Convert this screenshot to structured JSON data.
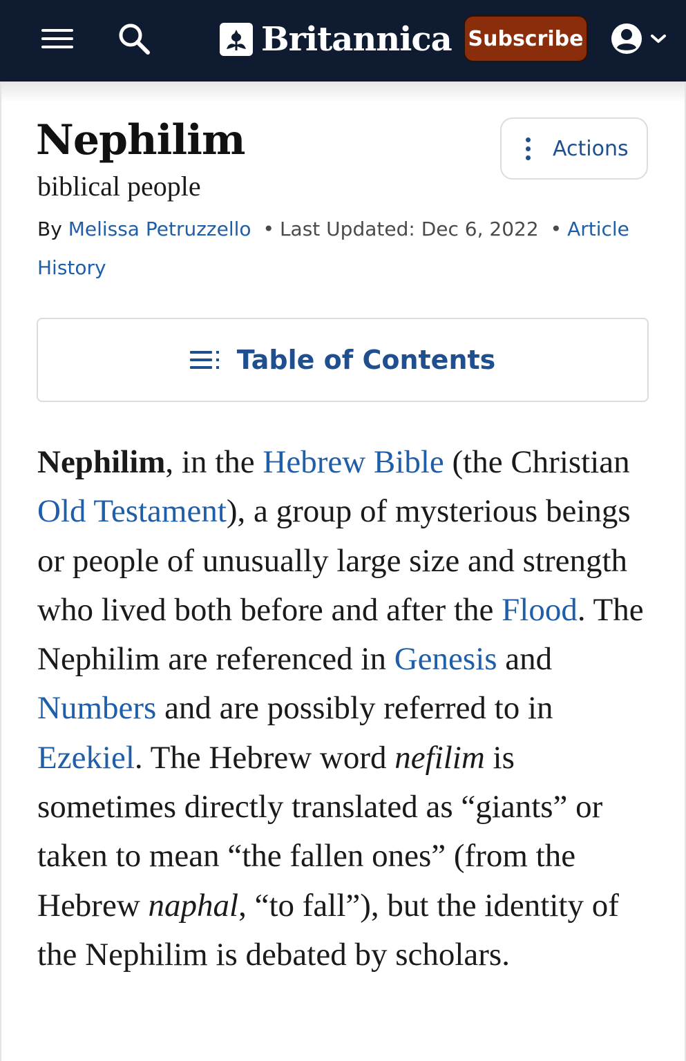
{
  "header": {
    "brand": "Britannica",
    "subscribe_label": "Subscribe",
    "background_color": "#0f1b30",
    "subscribe_color": "#8a2d0b",
    "icons": [
      "menu-icon",
      "search-icon",
      "thistle-logo-icon",
      "account-icon",
      "chevron-down-icon"
    ]
  },
  "article": {
    "title": "Nephilim",
    "subtitle": "biblical people",
    "actions_label": "Actions",
    "byline": {
      "by": "By",
      "author": "Melissa Petruzzello",
      "separator": "•",
      "last_updated": "Last Updated: Dec 6, 2022",
      "history_link": "Article History"
    },
    "toc_label": "Table of Contents",
    "link_color": "#1f5ea8",
    "paragraph": [
      {
        "t": "Nephilim",
        "s": "bold"
      },
      {
        "t": ", in the ",
        "s": "text"
      },
      {
        "t": "Hebrew Bible",
        "s": "link"
      },
      {
        "t": " (the Christian ",
        "s": "text"
      },
      {
        "t": "Old Testament",
        "s": "link"
      },
      {
        "t": "), a group of mysterious beings or people of unusually large size and strength who lived both before and after the ",
        "s": "text"
      },
      {
        "t": "Flood",
        "s": "link"
      },
      {
        "t": ". The Nephilim are referenced in ",
        "s": "text"
      },
      {
        "t": "Genesis",
        "s": "link"
      },
      {
        "t": " and ",
        "s": "text"
      },
      {
        "t": "Numbers",
        "s": "link"
      },
      {
        "t": " and are possibly referred to in ",
        "s": "text"
      },
      {
        "t": "Ezekiel",
        "s": "link"
      },
      {
        "t": ". The Hebrew word ",
        "s": "text"
      },
      {
        "t": "nefilim",
        "s": "italic"
      },
      {
        "t": " is sometimes directly translated as “giants” or taken to mean “the fallen ones” (from the Hebrew ",
        "s": "text"
      },
      {
        "t": "naphal",
        "s": "italic"
      },
      {
        "t": ", “to fall”), but the identity of the Nephilim is debated by scholars.",
        "s": "text"
      }
    ]
  }
}
